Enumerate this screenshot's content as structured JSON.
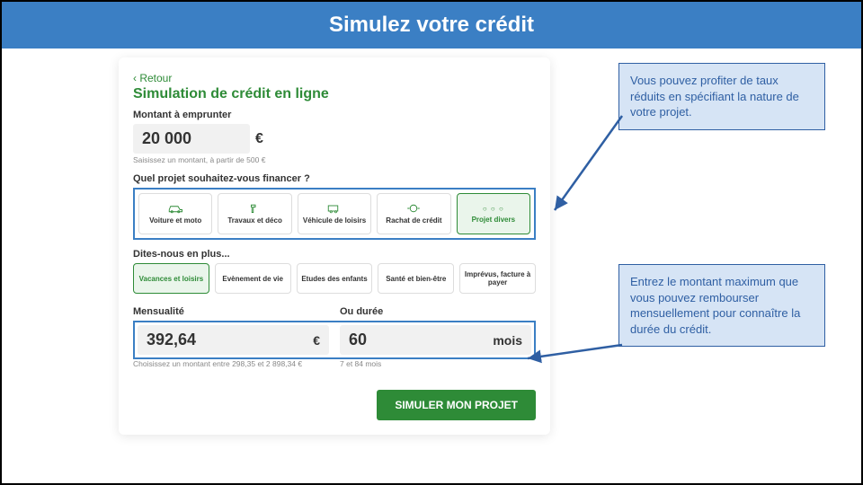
{
  "banner": {
    "title": "Simulez votre crédit"
  },
  "card": {
    "back": "‹ Retour",
    "title": "Simulation de crédit en ligne",
    "amount_label": "Montant à emprunter",
    "amount_value": "20 000",
    "amount_unit": "€",
    "amount_hint": "Saisissez un montant, à partir de 500 €",
    "project_question": "Quel projet souhaitez-vous financer ?",
    "projects": [
      {
        "label": "Voiture et moto"
      },
      {
        "label": "Travaux et déco"
      },
      {
        "label": "Véhicule de loisirs"
      },
      {
        "label": "Rachat de crédit"
      },
      {
        "label": "Projet divers"
      }
    ],
    "subhead": "Dites-nous en plus...",
    "subcats": [
      {
        "label": "Vacances et loisirs"
      },
      {
        "label": "Evènement de vie"
      },
      {
        "label": "Etudes des enfants"
      },
      {
        "label": "Santé et bien-être"
      },
      {
        "label": "Imprévus, facture à payer"
      }
    ],
    "monthly_label": "Mensualité",
    "monthly_value": "392,64",
    "monthly_unit": "€",
    "monthly_hint": "Choisissez un montant entre 298,35 et 2 898,34 €",
    "or_duration_label": "Ou durée",
    "duration_value": "60",
    "duration_unit": "mois",
    "duration_hint": "7 et 84 mois",
    "cta": "SIMULER MON PROJET"
  },
  "callouts": {
    "c1": "Vous pouvez profiter de taux réduits en spécifiant la nature de votre projet.",
    "c2": "Entrez le montant maximum que vous pouvez rembourser mensuellement pour connaître la durée du crédit."
  }
}
